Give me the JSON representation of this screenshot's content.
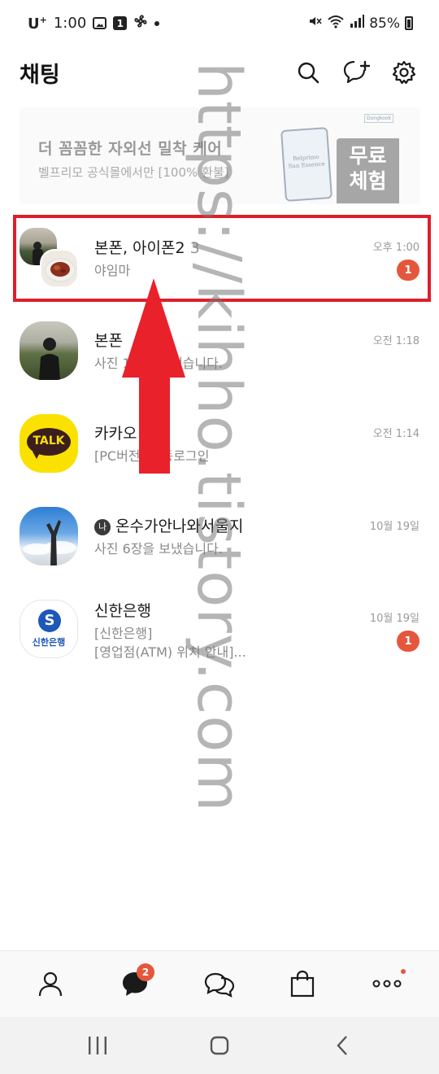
{
  "status_bar": {
    "carrier": "U",
    "carrier_sup": "+",
    "time": "1:00",
    "notif_num": "1",
    "battery": "85%"
  },
  "header": {
    "title": "채팅",
    "icons": [
      "search-icon",
      "new-chat-icon",
      "settings-icon"
    ]
  },
  "ad": {
    "title": "더 꼼꼼한 자외선 밀착 케어",
    "subtitle": "벨프리모 공식몰에서만 [100% 환불]",
    "badge_line1": "무료",
    "badge_line2": "체험"
  },
  "chats": [
    {
      "name": "본폰, 아이폰2",
      "count": "3",
      "preview": "야임마",
      "time": "오후 1:00",
      "unread": "1"
    },
    {
      "name": "본폰",
      "preview": "사진 1장을 보냈습니다.",
      "time": "오전 1:18"
    },
    {
      "name": "카카오",
      "preview": "[PC버전] 자동로그인",
      "time": "오전 1:14"
    },
    {
      "name": "온수가안나와서울지",
      "preview": "사진 6장을 보냈습니다.",
      "time": "10월 19일",
      "open_icon": "나"
    },
    {
      "name": "신한은행",
      "preview": "[신한은행]",
      "preview2": "[영업점(ATM) 위치 안내]...",
      "time": "10월 19일",
      "unread": "1"
    }
  ],
  "avatars": {
    "kakao_text": "TALK",
    "shinhan_text": "신한은행"
  },
  "watermark": "https://kihho.tistory.com",
  "bottom_tabs": {
    "chat_badge": "2",
    "icons": [
      "friends-icon",
      "chats-icon",
      "open-chat-icon",
      "shopping-icon",
      "more-icon"
    ]
  },
  "nav_bar": [
    "recent-apps-icon",
    "home-icon",
    "back-icon"
  ],
  "colors": {
    "accent_badge": "#e5573d",
    "highlight": "#de1f2a",
    "kakao_yellow": "#fae100"
  }
}
